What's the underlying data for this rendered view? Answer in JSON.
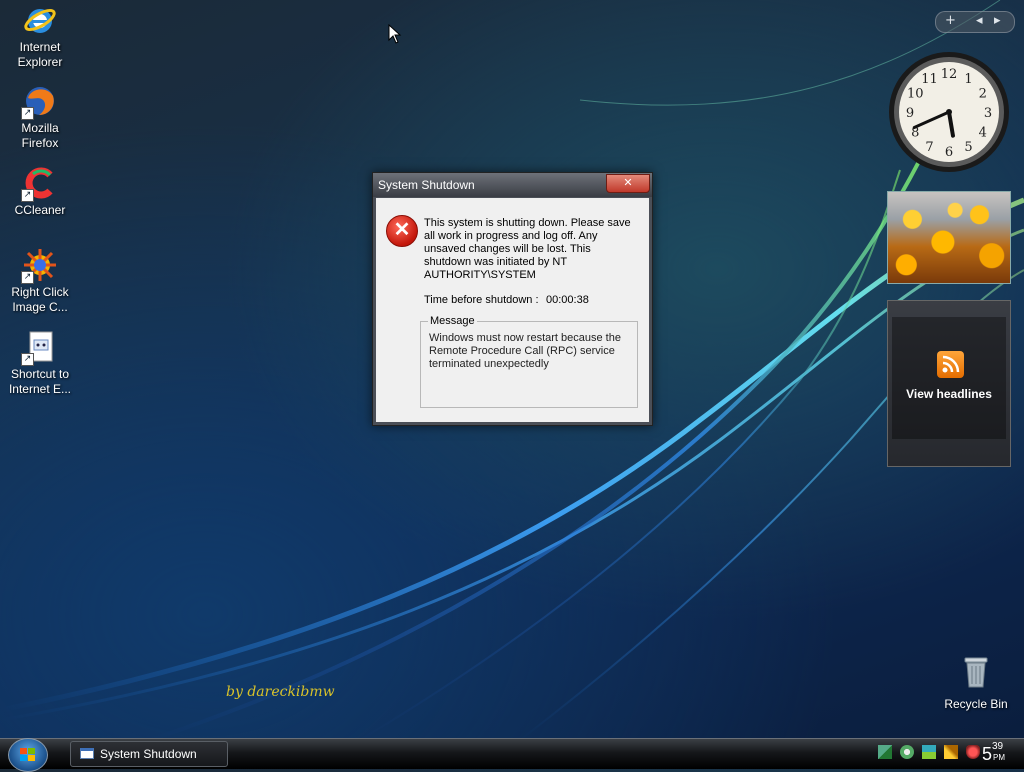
{
  "desktop_icons": [
    {
      "name": "internet-explorer",
      "label": "Internet\nExplorer"
    },
    {
      "name": "mozilla-firefox",
      "label": "Mozilla\nFirefox"
    },
    {
      "name": "ccleaner",
      "label": "CCleaner"
    },
    {
      "name": "right-click-image-converter",
      "label": "Right Click\nImage C..."
    },
    {
      "name": "shortcut-internet-explorer",
      "label": "Shortcut to\nInternet E..."
    }
  ],
  "dialog": {
    "title": "System Shutdown",
    "message": "This system is shutting down. Please save all work in progress and log off. Any unsaved changes will be lost. This shutdown was initiated by NT AUTHORITY\\SYSTEM",
    "time_label": "Time before shutdown :",
    "time_value": "00:00:38",
    "message_group_label": "Message",
    "message_detail": "Windows must now restart because the Remote Procedure Call (RPC) service terminated unexpectedly"
  },
  "sidebar": {
    "add_button": "+",
    "prev_button": "◂",
    "next_button": "▸",
    "clock_time": "5:41",
    "feeds_label": "View headlines"
  },
  "watermark": "by dareckibmw",
  "recycle_bin": {
    "label": "Recycle Bin"
  },
  "taskbar": {
    "task_label": "System Shutdown",
    "clock_hour": "5",
    "clock_minute": "39",
    "clock_ampm": "PM"
  },
  "colors": {
    "dialog_frame": "#4b4f57",
    "close_button": "#c0392b",
    "error_icon": "#c3170b",
    "watermark": "#d8c22a",
    "rss": "#e46d00"
  }
}
